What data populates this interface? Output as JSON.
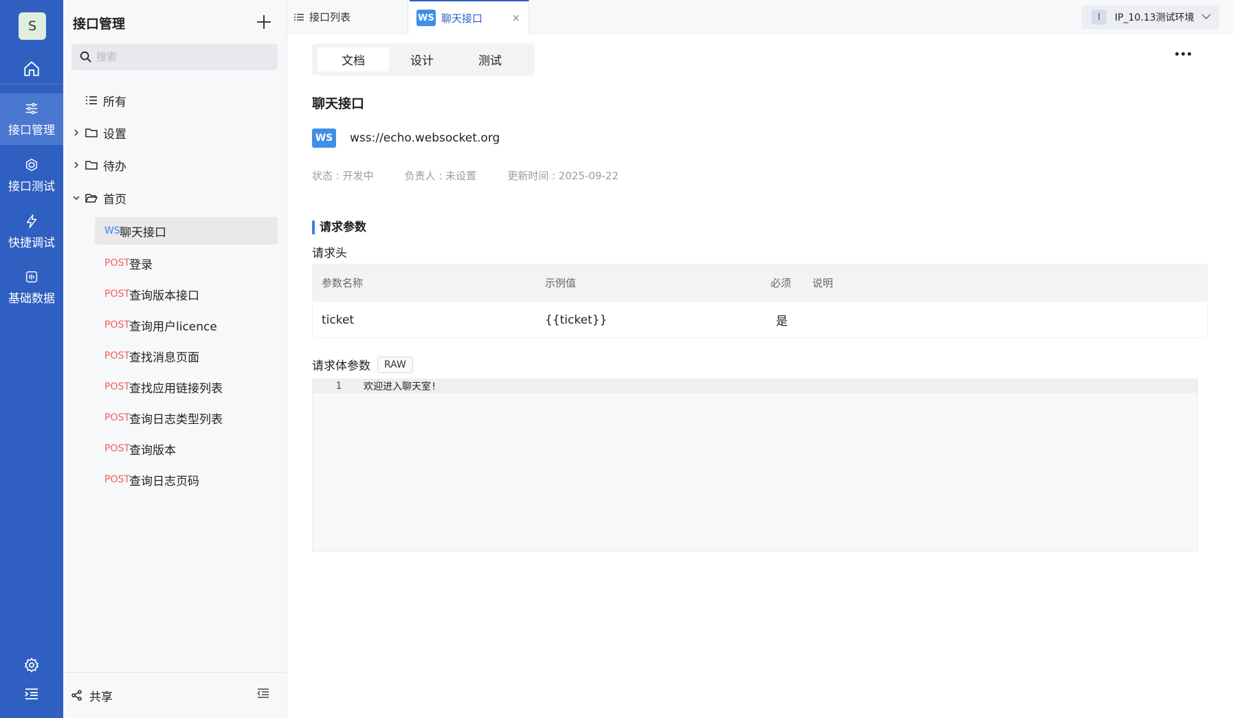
{
  "rail": {
    "avatar": "S",
    "items": [
      {
        "label": "接口管理",
        "icon": "sliders-icon",
        "active": true
      },
      {
        "label": "接口测试",
        "icon": "cube-icon",
        "active": false
      },
      {
        "label": "快捷调试",
        "icon": "lightning-icon",
        "active": false
      },
      {
        "label": "基础数据",
        "icon": "data-icon",
        "active": false
      }
    ]
  },
  "sidebar": {
    "title": "接口管理",
    "search_placeholder": "搜索",
    "all_label": "所有",
    "folders": [
      {
        "label": "设置",
        "expanded": false
      },
      {
        "label": "待办",
        "expanded": false
      },
      {
        "label": "首页",
        "expanded": true
      }
    ],
    "apis": [
      {
        "method": "WS",
        "label": "聊天接口",
        "active": true
      },
      {
        "method": "POST",
        "label": "登录"
      },
      {
        "method": "POST",
        "label": "查询版本接口"
      },
      {
        "method": "POST",
        "label": "查询用户licence"
      },
      {
        "method": "POST",
        "label": "查找消息页面"
      },
      {
        "method": "POST",
        "label": "查找应用链接列表"
      },
      {
        "method": "POST",
        "label": "查询日志类型列表"
      },
      {
        "method": "POST",
        "label": "查询版本"
      },
      {
        "method": "POST",
        "label": "查询日志页码"
      }
    ],
    "share_label": "共享"
  },
  "tabs": {
    "list_label": "接口列表",
    "chat_badge": "WS",
    "chat_label": "聊天接口",
    "close": "×"
  },
  "env": {
    "badge": "I",
    "label": "IP_10.13测试环境"
  },
  "segments": [
    "文档",
    "设计",
    "测试"
  ],
  "api": {
    "name": "聊天接口",
    "badge": "WS",
    "url": "wss://echo.websocket.org",
    "status": "状态 : 开发中",
    "owner": "负责人 : 未设置",
    "updated": "更新时间 : 2025-09-22"
  },
  "request": {
    "section_title": "请求参数",
    "headers_title": "请求头",
    "columns": [
      "参数名称",
      "示例值",
      "必须",
      "说明"
    ],
    "rows": [
      {
        "name": "ticket",
        "example": "{{ticket}}",
        "required": "是",
        "desc": ""
      }
    ],
    "body_label": "请求体参数",
    "body_type": "RAW",
    "editor_line_no": "1",
    "editor_code": "欢迎进入聊天室!"
  },
  "colors": {
    "rail": "#2f5fc0",
    "accent": "#3b7ff0",
    "post": "#ef5e5e"
  }
}
